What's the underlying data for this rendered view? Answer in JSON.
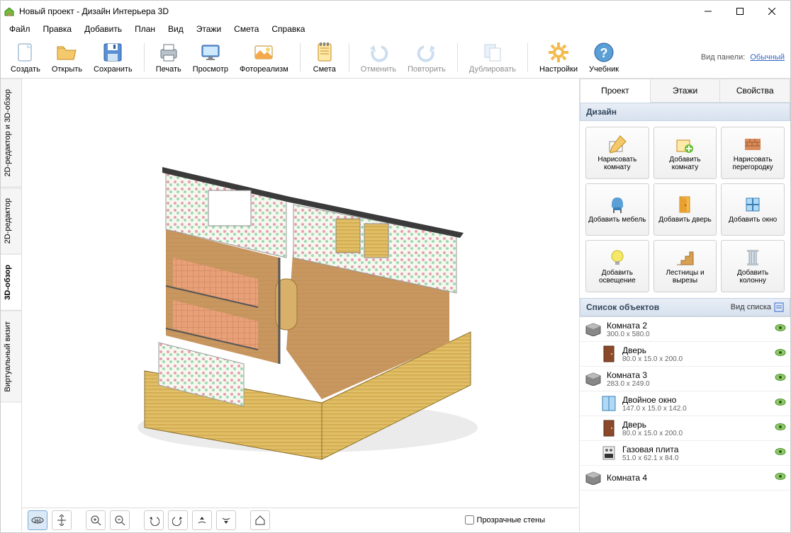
{
  "window": {
    "title": "Новый проект - Дизайн Интерьера 3D"
  },
  "menu": [
    "Файл",
    "Правка",
    "Добавить",
    "План",
    "Вид",
    "Этажи",
    "Смета",
    "Справка"
  ],
  "toolbar": {
    "create": "Создать",
    "open": "Открыть",
    "save": "Сохранить",
    "print": "Печать",
    "preview": "Просмотр",
    "photorealism": "Фотореализм",
    "estimate": "Смета",
    "undo": "Отменить",
    "redo": "Повторить",
    "duplicate": "Дублировать",
    "settings": "Настройки",
    "tutorial": "Учебник",
    "panel_label": "Вид панели:",
    "panel_link": "Обычный"
  },
  "left_tabs": {
    "t0": "2D-редактор и 3D-обзор",
    "t1": "2D-редактор",
    "t2": "3D-обзор",
    "t3": "Виртуальный визит"
  },
  "right_tabs": {
    "project": "Проект",
    "floors": "Этажи",
    "properties": "Свойства"
  },
  "design": {
    "header": "Дизайн",
    "draw_room": "Нарисовать комнату",
    "add_room": "Добавить комнату",
    "draw_partition": "Нарисовать перегородку",
    "add_furniture": "Добавить мебель",
    "add_door": "Добавить дверь",
    "add_window": "Добавить окно",
    "add_light": "Добавить освещение",
    "stairs": "Лестницы и вырезы",
    "add_column": "Добавить колонну"
  },
  "objects": {
    "header": "Список объектов",
    "view_type": "Вид списка",
    "items": [
      {
        "name": "Комната 2",
        "dims": "300.0 x 580.0",
        "type": "room",
        "indent": 0
      },
      {
        "name": "Дверь",
        "dims": "80.0 x 15.0 x 200.0",
        "type": "door",
        "indent": 1
      },
      {
        "name": "Комната 3",
        "dims": "283.0 x 249.0",
        "type": "room",
        "indent": 0
      },
      {
        "name": "Двойное окно",
        "dims": "147.0 x 15.0 x 142.0",
        "type": "window",
        "indent": 1
      },
      {
        "name": "Дверь",
        "dims": "80.0 x 15.0 x 200.0",
        "type": "door",
        "indent": 1
      },
      {
        "name": "Газовая плита",
        "dims": "51.0 x 62.1 x 84.0",
        "type": "stove",
        "indent": 1
      },
      {
        "name": "Комната 4",
        "dims": "",
        "type": "room",
        "indent": 0
      }
    ]
  },
  "viewbar": {
    "transparent_walls": "Прозрачные стены"
  }
}
